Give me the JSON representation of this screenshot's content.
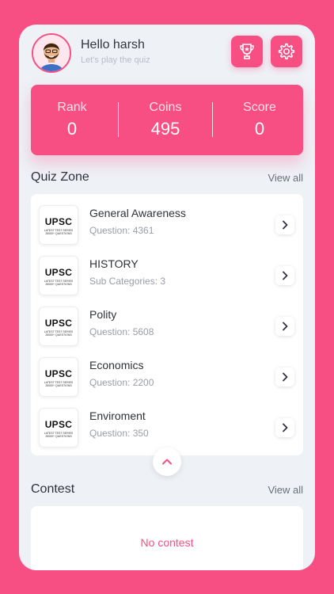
{
  "colors": {
    "accent": "#f74f84",
    "background": "#eef1f6",
    "card": "#ffffff"
  },
  "header": {
    "greeting": "Hello harsh",
    "subtitle": "Let's play the quiz",
    "trophy_icon": "trophy-icon",
    "settings_icon": "gear-icon"
  },
  "stats": [
    {
      "label": "Rank",
      "value": "0"
    },
    {
      "label": "Coins",
      "value": "495"
    },
    {
      "label": "Score",
      "value": "0"
    }
  ],
  "quiz_zone": {
    "title": "Quiz Zone",
    "view_all": "View all",
    "items": [
      {
        "logo": "UPSC",
        "tagline": "LATEST TEST SERIES 25000+ QUESTIONS",
        "name": "General Awareness",
        "meta": "Question: 4361"
      },
      {
        "logo": "UPSC",
        "tagline": "LATEST TEST SERIES 25000+ QUESTIONS",
        "name": "HISTORY",
        "meta": "Sub Categories: 3"
      },
      {
        "logo": "UPSC",
        "tagline": "LATEST TEST SERIES 25000+ QUESTIONS",
        "name": "Polity",
        "meta": "Question: 5608"
      },
      {
        "logo": "UPSC",
        "tagline": "LATEST TEST SERIES 25000+ QUESTIONS",
        "name": "Economics",
        "meta": "Question: 2200"
      },
      {
        "logo": "UPSC",
        "tagline": "LATEST TEST SERIES 25000+ QUESTIONS",
        "name": "Enviroment",
        "meta": "Question: 350"
      }
    ]
  },
  "contest": {
    "title": "Contest",
    "view_all": "View all",
    "empty_text": "No contest"
  }
}
